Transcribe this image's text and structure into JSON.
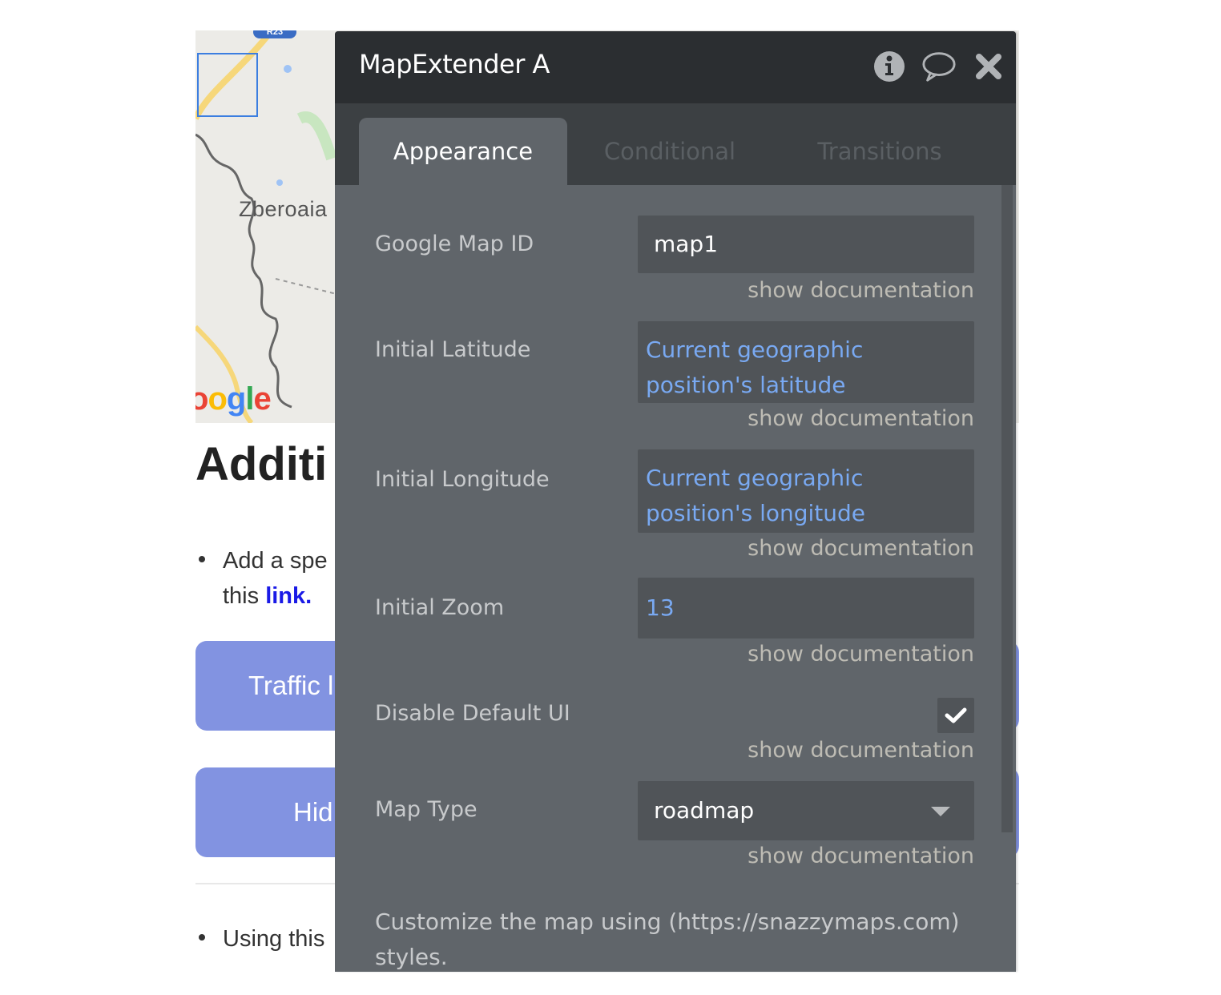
{
  "background_page": {
    "map": {
      "place_label": "Zberoaia",
      "road_badge": "R23",
      "attribution_logo": [
        "o",
        "o",
        "g",
        "l",
        "e"
      ]
    },
    "heading": "Additi",
    "bullet1_line1": "Add a spe",
    "bullet1_line2_prefix": "this ",
    "bullet1_link": "link.",
    "button_traffic": "Traffic l",
    "button_hide": "Hid",
    "bullet2_line1": "Using this",
    "colors": {
      "button": "#8293e1",
      "link": "#1a1ae6"
    }
  },
  "panel": {
    "title": "MapExtender A",
    "header_icons": [
      "info-icon",
      "comment-icon",
      "close-icon"
    ],
    "tabs": [
      {
        "label": "Appearance",
        "active": true
      },
      {
        "label": "Conditional",
        "active": false
      },
      {
        "label": "Transitions",
        "active": false
      }
    ],
    "properties": [
      {
        "label": "Google Map ID",
        "value": "map1",
        "type": "text"
      },
      {
        "label": "Initial Latitude",
        "value": "Current geographic position's latitude",
        "type": "dynamic"
      },
      {
        "label": "Initial Longitude",
        "value": "Current geographic position's longitude",
        "type": "dynamic"
      },
      {
        "label": "Initial Zoom",
        "value": "13",
        "type": "dynamic"
      },
      {
        "label": "Disable Default UI",
        "checked": true,
        "type": "checkbox"
      },
      {
        "label": "Map Type",
        "value": "roadmap",
        "type": "select"
      }
    ],
    "show_documentation": "show documentation",
    "note": "Customize the map using (https://snazzymaps.com) styles.",
    "colors": {
      "header_bg": "#2b2e31",
      "tabbar_bg": "#3c4043",
      "body_bg": "#60656a",
      "input_bg": "#505458",
      "dynamic_value": "#79a9f2"
    }
  }
}
